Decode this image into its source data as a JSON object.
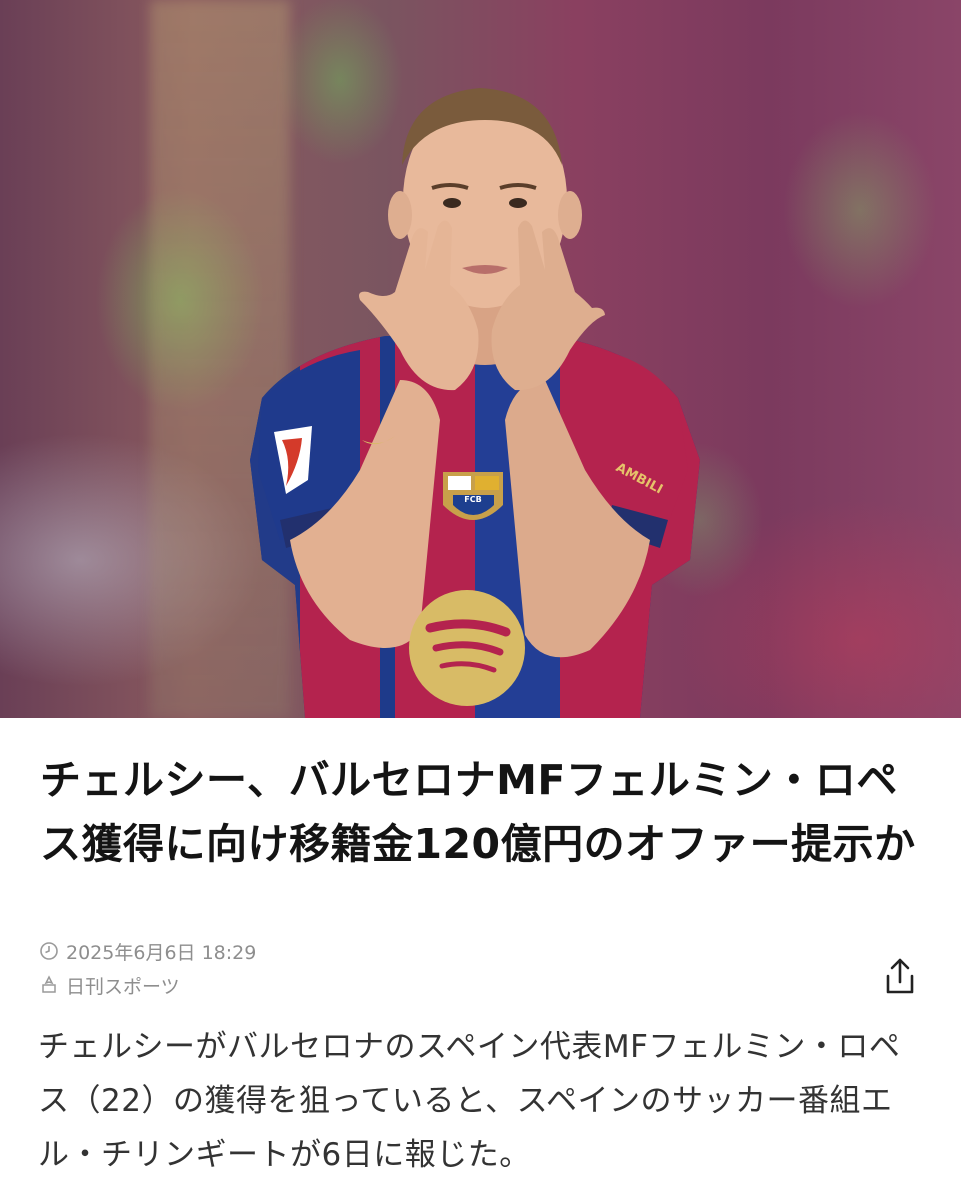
{
  "article": {
    "hero_image": {
      "alt": "",
      "crest_text": "FCB",
      "sleeve_text": "AMBILI"
    },
    "headline": "チェルシー、バルセロナMFフェルミン・ロペス獲得に向け移籍金120億円のオファー提示か",
    "timestamp": "2025年6月6日 18:29",
    "source": "日刊スポーツ",
    "body": "チェルシーがバルセロナのスペイン代表MFフェルミン・ロペス（22）の獲得を狙っていると、スペインのサッカー番組エル・チリンギートが6日に報じた。",
    "icons": {
      "clock": "clock-icon",
      "source": "source-icon",
      "share": "share-icon"
    }
  },
  "colors": {
    "jersey_blue": "#1e3a8a",
    "jersey_red": "#b4234e",
    "sponsor_gold": "#d8bb66",
    "meta_gray": "#8e8e8e"
  }
}
